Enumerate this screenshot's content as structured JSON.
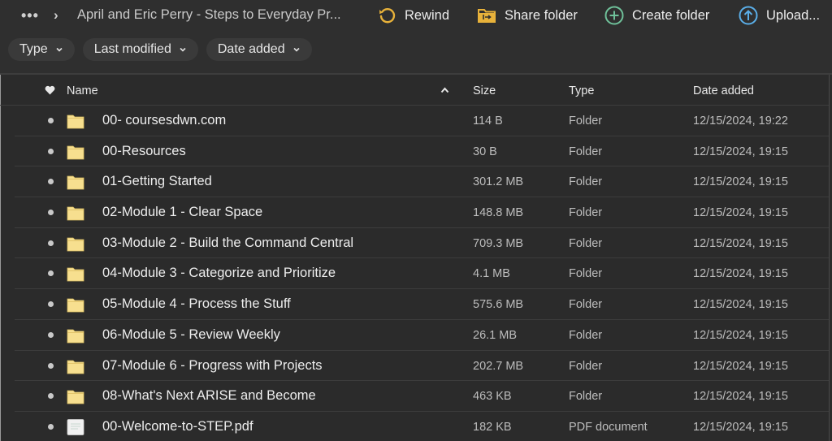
{
  "breadcrumb": {
    "more_label": "•••",
    "separator": "›",
    "current": "April and Eric Perry - Steps to Everyday Pr..."
  },
  "toolbar": {
    "rewind_label": "Rewind",
    "share_folder_label": "Share folder",
    "create_folder_label": "Create folder",
    "upload_label": "Upload..."
  },
  "filters": [
    {
      "label": "Type"
    },
    {
      "label": "Last modified"
    },
    {
      "label": "Date added"
    }
  ],
  "colors": {
    "rewind": "#e8b23a",
    "share": "#e8b23a",
    "create": "#6fc19a",
    "upload": "#5aaee8",
    "folder": "#f7df8f"
  },
  "table": {
    "headers": {
      "name": "Name",
      "size": "Size",
      "type": "Type",
      "date_added": "Date added"
    },
    "sort": {
      "column": "Name",
      "direction": "ascending"
    },
    "rows": [
      {
        "name": "00- coursesdwn.com",
        "size": "114 B",
        "type": "Folder",
        "date_added": "12/15/2024, 19:22",
        "icon": "folder-icon"
      },
      {
        "name": "00-Resources",
        "size": "30 B",
        "type": "Folder",
        "date_added": "12/15/2024, 19:15",
        "icon": "folder-icon"
      },
      {
        "name": "01-Getting Started",
        "size": "301.2 MB",
        "type": "Folder",
        "date_added": "12/15/2024, 19:15",
        "icon": "folder-icon"
      },
      {
        "name": "02-Module 1 - Clear Space",
        "size": "148.8 MB",
        "type": "Folder",
        "date_added": "12/15/2024, 19:15",
        "icon": "folder-icon"
      },
      {
        "name": "03-Module 2 - Build the Command Central",
        "size": "709.3 MB",
        "type": "Folder",
        "date_added": "12/15/2024, 19:15",
        "icon": "folder-icon"
      },
      {
        "name": "04-Module 3 - Categorize and Prioritize",
        "size": "4.1 MB",
        "type": "Folder",
        "date_added": "12/15/2024, 19:15",
        "icon": "folder-icon"
      },
      {
        "name": "05-Module 4 - Process the Stuff",
        "size": "575.6 MB",
        "type": "Folder",
        "date_added": "12/15/2024, 19:15",
        "icon": "folder-icon"
      },
      {
        "name": "06-Module 5 - Review Weekly",
        "size": "26.1 MB",
        "type": "Folder",
        "date_added": "12/15/2024, 19:15",
        "icon": "folder-icon"
      },
      {
        "name": "07-Module 6 - Progress with Projects",
        "size": "202.7 MB",
        "type": "Folder",
        "date_added": "12/15/2024, 19:15",
        "icon": "folder-icon"
      },
      {
        "name": "08-What's Next ARISE and Become",
        "size": "463 KB",
        "type": "Folder",
        "date_added": "12/15/2024, 19:15",
        "icon": "folder-icon"
      },
      {
        "name": "00-Welcome-to-STEP.pdf",
        "size": "182 KB",
        "type": "PDF document",
        "date_added": "12/15/2024, 19:15",
        "icon": "pdf-file-icon"
      }
    ]
  }
}
